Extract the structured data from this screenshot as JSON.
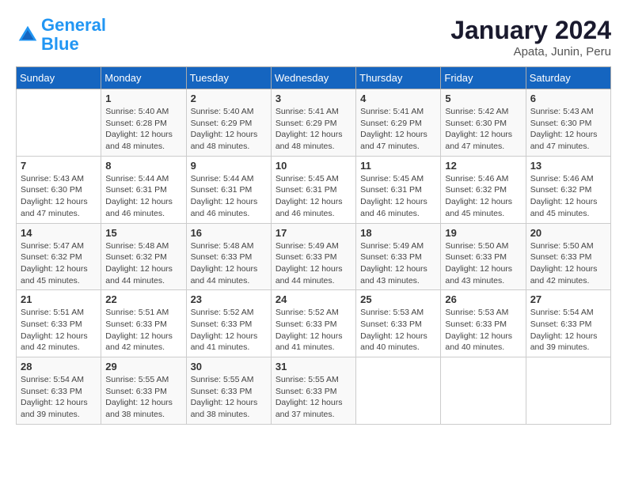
{
  "header": {
    "logo_line1": "General",
    "logo_line2": "Blue",
    "month": "January 2024",
    "location": "Apata, Junin, Peru"
  },
  "weekdays": [
    "Sunday",
    "Monday",
    "Tuesday",
    "Wednesday",
    "Thursday",
    "Friday",
    "Saturday"
  ],
  "weeks": [
    [
      {
        "day": "",
        "info": ""
      },
      {
        "day": "1",
        "info": "Sunrise: 5:40 AM\nSunset: 6:28 PM\nDaylight: 12 hours\nand 48 minutes."
      },
      {
        "day": "2",
        "info": "Sunrise: 5:40 AM\nSunset: 6:29 PM\nDaylight: 12 hours\nand 48 minutes."
      },
      {
        "day": "3",
        "info": "Sunrise: 5:41 AM\nSunset: 6:29 PM\nDaylight: 12 hours\nand 48 minutes."
      },
      {
        "day": "4",
        "info": "Sunrise: 5:41 AM\nSunset: 6:29 PM\nDaylight: 12 hours\nand 47 minutes."
      },
      {
        "day": "5",
        "info": "Sunrise: 5:42 AM\nSunset: 6:30 PM\nDaylight: 12 hours\nand 47 minutes."
      },
      {
        "day": "6",
        "info": "Sunrise: 5:43 AM\nSunset: 6:30 PM\nDaylight: 12 hours\nand 47 minutes."
      }
    ],
    [
      {
        "day": "7",
        "info": "Sunrise: 5:43 AM\nSunset: 6:30 PM\nDaylight: 12 hours\nand 47 minutes."
      },
      {
        "day": "8",
        "info": "Sunrise: 5:44 AM\nSunset: 6:31 PM\nDaylight: 12 hours\nand 46 minutes."
      },
      {
        "day": "9",
        "info": "Sunrise: 5:44 AM\nSunset: 6:31 PM\nDaylight: 12 hours\nand 46 minutes."
      },
      {
        "day": "10",
        "info": "Sunrise: 5:45 AM\nSunset: 6:31 PM\nDaylight: 12 hours\nand 46 minutes."
      },
      {
        "day": "11",
        "info": "Sunrise: 5:45 AM\nSunset: 6:31 PM\nDaylight: 12 hours\nand 46 minutes."
      },
      {
        "day": "12",
        "info": "Sunrise: 5:46 AM\nSunset: 6:32 PM\nDaylight: 12 hours\nand 45 minutes."
      },
      {
        "day": "13",
        "info": "Sunrise: 5:46 AM\nSunset: 6:32 PM\nDaylight: 12 hours\nand 45 minutes."
      }
    ],
    [
      {
        "day": "14",
        "info": "Sunrise: 5:47 AM\nSunset: 6:32 PM\nDaylight: 12 hours\nand 45 minutes."
      },
      {
        "day": "15",
        "info": "Sunrise: 5:48 AM\nSunset: 6:32 PM\nDaylight: 12 hours\nand 44 minutes."
      },
      {
        "day": "16",
        "info": "Sunrise: 5:48 AM\nSunset: 6:33 PM\nDaylight: 12 hours\nand 44 minutes."
      },
      {
        "day": "17",
        "info": "Sunrise: 5:49 AM\nSunset: 6:33 PM\nDaylight: 12 hours\nand 44 minutes."
      },
      {
        "day": "18",
        "info": "Sunrise: 5:49 AM\nSunset: 6:33 PM\nDaylight: 12 hours\nand 43 minutes."
      },
      {
        "day": "19",
        "info": "Sunrise: 5:50 AM\nSunset: 6:33 PM\nDaylight: 12 hours\nand 43 minutes."
      },
      {
        "day": "20",
        "info": "Sunrise: 5:50 AM\nSunset: 6:33 PM\nDaylight: 12 hours\nand 42 minutes."
      }
    ],
    [
      {
        "day": "21",
        "info": "Sunrise: 5:51 AM\nSunset: 6:33 PM\nDaylight: 12 hours\nand 42 minutes."
      },
      {
        "day": "22",
        "info": "Sunrise: 5:51 AM\nSunset: 6:33 PM\nDaylight: 12 hours\nand 42 minutes."
      },
      {
        "day": "23",
        "info": "Sunrise: 5:52 AM\nSunset: 6:33 PM\nDaylight: 12 hours\nand 41 minutes."
      },
      {
        "day": "24",
        "info": "Sunrise: 5:52 AM\nSunset: 6:33 PM\nDaylight: 12 hours\nand 41 minutes."
      },
      {
        "day": "25",
        "info": "Sunrise: 5:53 AM\nSunset: 6:33 PM\nDaylight: 12 hours\nand 40 minutes."
      },
      {
        "day": "26",
        "info": "Sunrise: 5:53 AM\nSunset: 6:33 PM\nDaylight: 12 hours\nand 40 minutes."
      },
      {
        "day": "27",
        "info": "Sunrise: 5:54 AM\nSunset: 6:33 PM\nDaylight: 12 hours\nand 39 minutes."
      }
    ],
    [
      {
        "day": "28",
        "info": "Sunrise: 5:54 AM\nSunset: 6:33 PM\nDaylight: 12 hours\nand 39 minutes."
      },
      {
        "day": "29",
        "info": "Sunrise: 5:55 AM\nSunset: 6:33 PM\nDaylight: 12 hours\nand 38 minutes."
      },
      {
        "day": "30",
        "info": "Sunrise: 5:55 AM\nSunset: 6:33 PM\nDaylight: 12 hours\nand 38 minutes."
      },
      {
        "day": "31",
        "info": "Sunrise: 5:55 AM\nSunset: 6:33 PM\nDaylight: 12 hours\nand 37 minutes."
      },
      {
        "day": "",
        "info": ""
      },
      {
        "day": "",
        "info": ""
      },
      {
        "day": "",
        "info": ""
      }
    ]
  ]
}
